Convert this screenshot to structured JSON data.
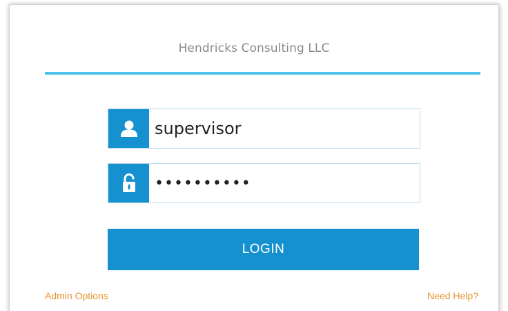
{
  "login": {
    "company_name": "Hendricks Consulting LLC",
    "username_value": "supervisor",
    "password_value": "••••••••••",
    "login_label": "LOGIN",
    "admin_options_label": "Admin Options",
    "need_help_label": "Need Help?"
  },
  "icons": {
    "username": "user-icon",
    "password": "lock-icon"
  },
  "colors": {
    "accent": "#1691cf",
    "rule": "#4ec0e8",
    "link": "#e8922e",
    "title_text": "#8a8a8a"
  }
}
